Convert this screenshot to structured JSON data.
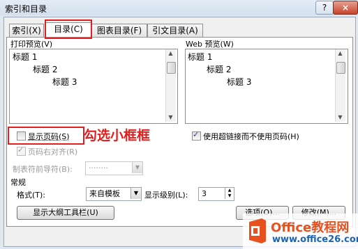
{
  "window": {
    "title": "索引和目录",
    "help": "?",
    "close": "×"
  },
  "tabs": [
    "索引(X)",
    "目录(C)",
    "图表目录(F)",
    "引文目录(A)"
  ],
  "print_preview": {
    "label": "打印预览(V)",
    "items": [
      "标题 1",
      "标题 2",
      "标题 3"
    ]
  },
  "web_preview": {
    "label": "Web 预览(W)",
    "items": [
      "标题 1",
      "标题 2",
      "标题 3"
    ]
  },
  "options": {
    "show_page_numbers": "显示页码(S)",
    "right_align": "页码右对齐(R)",
    "tab_leader_label": "制表符前导符(B):",
    "tab_leader_value": "........",
    "hyperlinks": "使用超链接而不使用页码(H)"
  },
  "general": {
    "label": "常规",
    "format_label": "格式(T):",
    "format_value": "来自模板",
    "levels_label": "显示级别(L):",
    "levels_value": "3"
  },
  "buttons": {
    "outline": "显示大纲工具栏(U)",
    "options": "选项(O)...",
    "modify": "修改(M)..."
  },
  "annotation": "勾选小框框",
  "watermark": {
    "brand": "Office教程网",
    "url": "www.office26.com"
  },
  "colors": {
    "annotation_red": "#e0201e",
    "brand_orange": "#e8501f",
    "brand_blue": "#1b62b5"
  }
}
